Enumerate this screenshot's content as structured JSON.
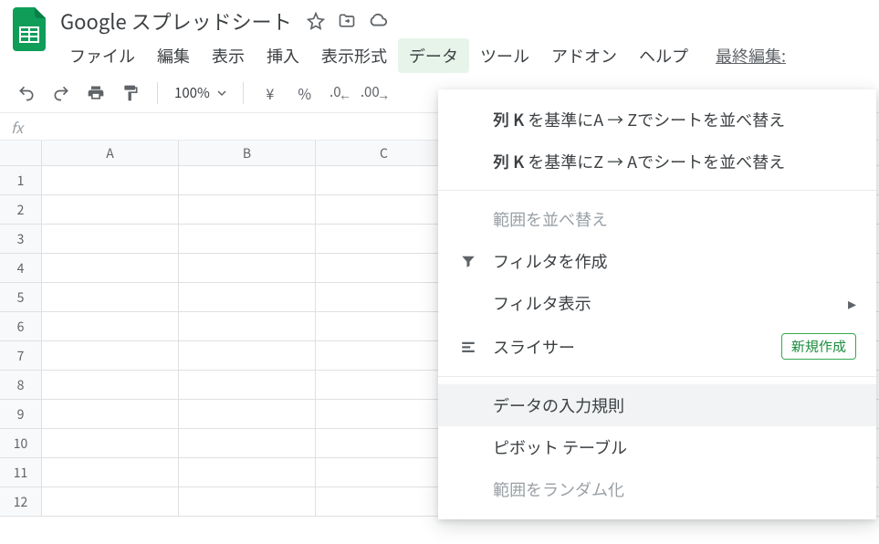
{
  "header": {
    "title": "Google スプレッドシート",
    "last_edit": "最終編集:"
  },
  "menubar": {
    "items": [
      "ファイル",
      "編集",
      "表示",
      "挿入",
      "表示形式",
      "データ",
      "ツール",
      "アドオン",
      "ヘルプ"
    ],
    "active_index": 5
  },
  "toolbar": {
    "zoom": "100%",
    "currency": "¥",
    "percent": "%"
  },
  "fx": {
    "label": "fx",
    "value": ""
  },
  "sheet": {
    "columns": [
      "A",
      "B",
      "C"
    ],
    "rows": [
      "1",
      "2",
      "3",
      "4",
      "5",
      "6",
      "7",
      "8",
      "9",
      "10",
      "11",
      "12"
    ]
  },
  "dropdown": {
    "sort_az_prefix": "列 K",
    "sort_az_rest": " を基準にA → Zでシートを並べ替え",
    "sort_za_prefix": "列 K",
    "sort_za_rest": " を基準にZ → Aでシートを並べ替え",
    "sort_range": "範囲を並べ替え",
    "create_filter": "フィルタを作成",
    "filter_view": "フィルタ表示",
    "slicer": "スライサー",
    "slicer_badge": "新規作成",
    "data_validation": "データの入力規則",
    "pivot_table": "ピボット テーブル",
    "randomize": "範囲をランダム化"
  }
}
